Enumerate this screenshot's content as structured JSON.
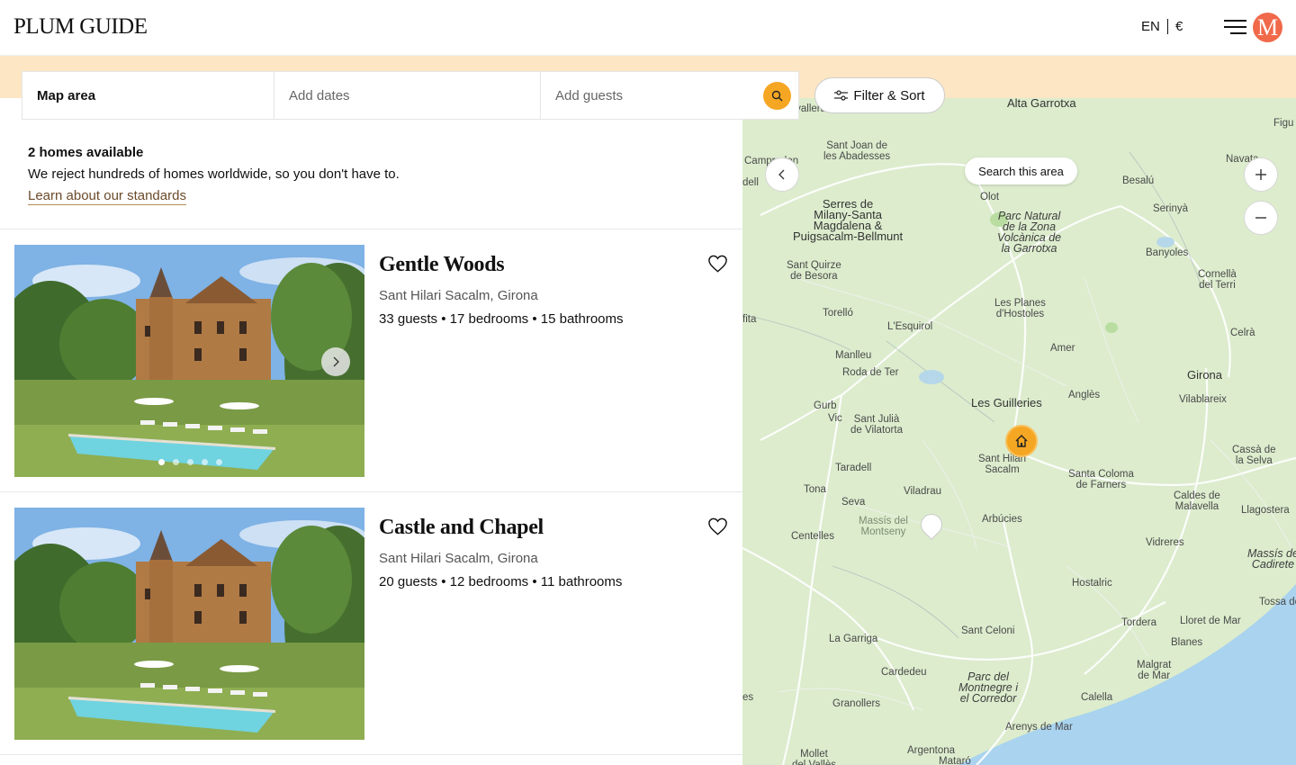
{
  "header": {
    "logo": "PLUM GUIDE",
    "language": "EN",
    "currency": "€",
    "avatar_initial": "M"
  },
  "search": {
    "location": "Map area",
    "dates_placeholder": "Add dates",
    "guests_placeholder": "Add guests",
    "filter_label": "Filter & Sort"
  },
  "results": {
    "count": "2 homes available",
    "tagline": "We reject hundreds of homes worldwide, so you don't have to.",
    "standards_link": "Learn about our standards"
  },
  "listings": [
    {
      "title": "Gentle Woods",
      "location": "Sant Hilari Sacalm, Girona",
      "meta": "33 guests • 17 bedrooms • 15 bathrooms"
    },
    {
      "title": "Castle and Chapel",
      "location": "Sant Hilari Sacalm, Girona",
      "meta": "20 guests • 12 bedrooms • 11 bathrooms"
    }
  ],
  "map": {
    "search_area_label": "Search this area",
    "labels": {
      "alta_garrotxa": "Alta Garrotxa",
      "sant_joan": "Sant Joan de\nles Abadesses",
      "olot": "Olot",
      "besalu": "Besalú",
      "navata": "Navata",
      "serres": "Serres de\nMilany-Santa\nMagdalena &\nPuigsacalm-Bellmunt",
      "parc_garrotxa": "Parc Natural\nde la Zona\nVolcànica de\nla Garrotxa",
      "serinya": "Serinyà",
      "sant_quirze": "Sant Quirze\nde Besora",
      "banyoles": "Banyoles",
      "cornella": "Cornellà\ndel Terri",
      "torello": "Torelló",
      "les_planes": "Les Planes\nd'Hostoles",
      "celra": "Celrà",
      "lesquirol": "L'Esquirol",
      "amer": "Amer",
      "manlleu": "Manlleu",
      "roda": "Roda de Ter",
      "girona": "Girona",
      "les_guilleries": "Les Guilleries",
      "angles": "Anglès",
      "vilablareix": "Vilablareix",
      "gurb": "Gurb",
      "vic": "Vic",
      "sant_julia": "Sant Julià\nde Vilatorta",
      "sant_hilari": "Sant Hilari\nSacalm",
      "santa_coloma": "Santa Coloma\nde Farners",
      "cassa": "Cassà de\nla Selva",
      "taradell": "Taradell",
      "tona": "Tona",
      "viladrau": "Viladrau",
      "seva": "Seva",
      "arbucies": "Arbúcies",
      "caldes": "Caldes de\nMalavella",
      "llagostera": "Llagostera",
      "montseny": "Massís del\nMontseny",
      "centelles": "Centelles",
      "vidreres": "Vidreres",
      "cadiretes": "Massís de\nCadirete",
      "hostalric": "Hostalric",
      "tossa": "Tossa de",
      "tordera": "Tordera",
      "lloret": "Lloret de Mar",
      "sant_celoni": "Sant Celoni",
      "blanes": "Blanes",
      "la_garriga": "La Garriga",
      "malgrat": "Malgrat\nde Mar",
      "cardedeu": "Cardedeu",
      "parc_montnegre": "Parc del\nMontnegre i\nel Corredor",
      "granollers": "Granollers",
      "calella": "Calella",
      "arenys": "Arenys de Mar",
      "mollet": "Mollet\ndel Vallès",
      "argentona": "Argentona",
      "mataro": "Mataró",
      "camprodon": "Camprodon",
      "fita": "fita",
      "figueres": "Figu",
      "sant_cavall": "ra Cavallera",
      "dell": "dell",
      "es": "es"
    }
  },
  "colors": {
    "accent": "#f5a623",
    "strip": "#fde6c4",
    "map_land": "#dceccd",
    "map_sea": "#a9d3ee",
    "avatar": "#f0694a"
  }
}
